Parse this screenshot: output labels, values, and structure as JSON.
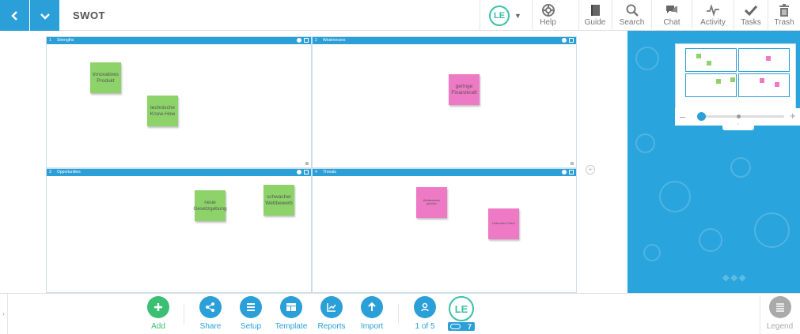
{
  "header": {
    "title": "SWOT",
    "user_initials": "LE",
    "tools": [
      {
        "id": "help",
        "label": "Help",
        "icon": "lifebuoy-icon"
      },
      {
        "id": "guide",
        "label": "Guide",
        "icon": "book-icon"
      },
      {
        "id": "search",
        "label": "Search",
        "icon": "search-icon"
      },
      {
        "id": "chat",
        "label": "Chat",
        "icon": "chat-icon"
      },
      {
        "id": "activity",
        "label": "Activity",
        "icon": "activity-icon"
      },
      {
        "id": "tasks",
        "label": "Tasks",
        "icon": "checkmark-icon"
      },
      {
        "id": "trash",
        "label": "Trash",
        "icon": "trash-icon"
      }
    ]
  },
  "board": {
    "quadrants": [
      {
        "number": "1",
        "title": "Strengths"
      },
      {
        "number": "2",
        "title": "Weaknesses"
      },
      {
        "number": "3",
        "title": "Opportunities"
      },
      {
        "number": "4",
        "title": "Threats"
      }
    ],
    "notes": [
      {
        "text": "Innovatives Produkt",
        "color": "#8ed36a"
      },
      {
        "text": "technische Know-How",
        "color": "#8ed36a"
      },
      {
        "text": "geringe Finanzkraft",
        "color": "#ee79c4"
      },
      {
        "text": "neue Gesetzgebung",
        "color": "#8ed36a"
      },
      {
        "text": "schwacher Wettbewerb",
        "color": "#8ed36a"
      },
      {
        "text": "Wettbewerber gründen",
        "color": "#ee79c4"
      },
      {
        "text": "Lieferanten-Fusion",
        "color": "#ee79c4"
      }
    ]
  },
  "bottom": {
    "buttons": [
      {
        "id": "add",
        "label": "Add",
        "icon": "plus-icon"
      },
      {
        "id": "share",
        "label": "Share",
        "icon": "share-icon"
      },
      {
        "id": "setup",
        "label": "Setup",
        "icon": "menu-icon"
      },
      {
        "id": "template",
        "label": "Template",
        "icon": "template-icon"
      },
      {
        "id": "reports",
        "label": "Reports",
        "icon": "chart-icon"
      },
      {
        "id": "import",
        "label": "Import",
        "icon": "upload-icon"
      },
      {
        "id": "participants",
        "label": "1 of 5",
        "icon": "person-icon"
      }
    ],
    "user_initials": "LE",
    "online_count": "7",
    "legend_label": "Legend"
  },
  "colors": {
    "accent": "#2a9fd8",
    "green_note": "#8ed36a",
    "pink_note": "#ee79c4",
    "user_ring": "#3bbfa8"
  }
}
